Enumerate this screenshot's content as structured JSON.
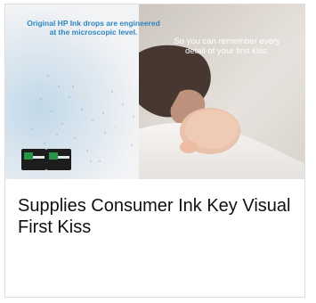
{
  "card": {
    "title": "Supplies Consumer Ink Key Visual First Kiss",
    "image": {
      "overlay_left": "Original HP Ink drops are engineered at the microscopic level.",
      "overlay_right": "So you can remember every detail of your first kiss."
    }
  },
  "colors": {
    "accent_blue": "#2e86c1",
    "caption_text": "#0f0f0f"
  }
}
